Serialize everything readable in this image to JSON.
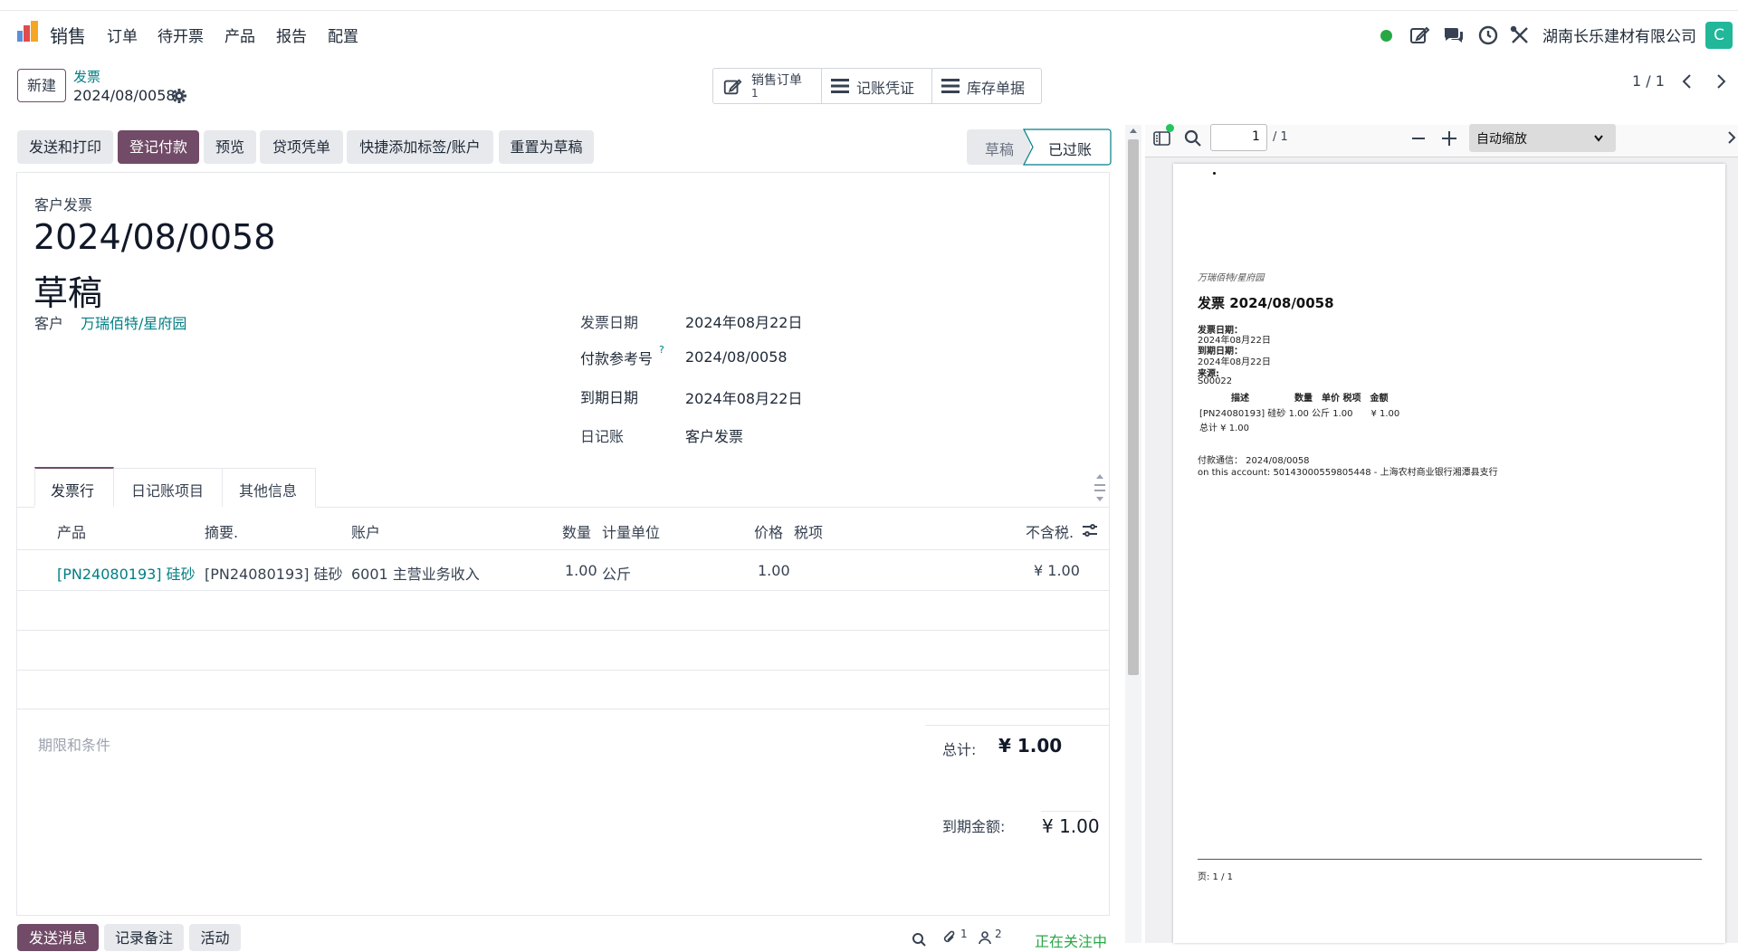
{
  "navbar": {
    "app_name": "销售",
    "menu": [
      "订单",
      "待开票",
      "产品",
      "报告",
      "配置"
    ],
    "company": "湖南长乐建材有限公司",
    "avatar_letter": "C"
  },
  "control_panel": {
    "new_label": "新建",
    "breadcrumb_parent": "发票",
    "breadcrumb_current": "2024/08/0058",
    "smart_buttons": {
      "sale_order_label": "销售订单",
      "sale_order_count": "1",
      "journal_entry_label": "记账凭证",
      "stock_label": "库存单据"
    },
    "pager": "1 / 1"
  },
  "actions": {
    "send_print": "发送和打印",
    "register_payment": "登记付款",
    "preview": "预览",
    "credit_note": "贷项凭单",
    "quick_tag": "快捷添加标签/账户",
    "reset_draft": "重置为草稿"
  },
  "status_bar": {
    "draft": "草稿",
    "posted": "已过账"
  },
  "form": {
    "move_type": "客户发票",
    "number": "2024/08/0058",
    "state": "草稿",
    "customer_label": "客户",
    "customer_value": "万瑞佰特/星府园",
    "invoice_date_label": "发票日期",
    "invoice_date_value": "2024年08月22日",
    "payment_ref_label": "付款参考号",
    "payment_ref_help": "?",
    "payment_ref_value": "2024/08/0058",
    "due_date_label": "到期日期",
    "due_date_value": "2024年08月22日",
    "journal_label": "日记账",
    "journal_value": "客户发票"
  },
  "tabs": {
    "invoice_lines": "发票行",
    "journal_items": "日记账项目",
    "other_info": "其他信息"
  },
  "lines_table": {
    "headers": {
      "product": "产品",
      "label": "摘要.",
      "account": "账户",
      "quantity": "数量",
      "uom": "计量单位",
      "price": "价格",
      "taxes": "税项",
      "subtotal": "不含税."
    },
    "rows": [
      {
        "product": "[PN24080193] 硅砂",
        "label": "[PN24080193] 硅砂",
        "account": "6001 主营业务收入",
        "quantity": "1.00",
        "uom": "公斤",
        "price": "1.00",
        "taxes": "",
        "subtotal": "¥ 1.00"
      }
    ]
  },
  "totals": {
    "terms_placeholder": "期限和条件",
    "total_label": "总计:",
    "total_value": "¥ 1.00",
    "due_label": "到期金额:",
    "due_value": "¥ 1.00"
  },
  "chatter": {
    "send_message": "发送消息",
    "log_note": "记录备注",
    "activity": "活动",
    "attachments_count": "1",
    "followers_count": "2",
    "following": "正在关注中"
  },
  "pdf_viewer": {
    "page_input": "1",
    "page_total": "/ 1",
    "zoom": "自动缩放",
    "doc": {
      "partner": "万瑞佰特/星府园",
      "title": "发票 2024/08/0058",
      "invoice_date_label": "发票日期：",
      "invoice_date": "2024年08月22日",
      "due_date_label": "到期日期：",
      "due_date": "2024年08月22日",
      "source_label": "来源:",
      "source": "S00022",
      "table_header": "描述　　　　　数量　单价 税项　金额",
      "table_row": "[PN24080193] 硅砂 1.00 公斤 1.00　　¥ 1.00",
      "total_line": "总计 ¥ 1.00",
      "payment_comm": "付款通信：  2024/08/0058",
      "account_line": "on this account: 50143000559805448 - 上海农村商业银行湘潭县支行",
      "footer": "页: 1 / 1"
    }
  },
  "colors": {
    "primary": "#714b67",
    "link": "#017e84",
    "online": "#28a745",
    "avatar_bg": "#21b799"
  }
}
